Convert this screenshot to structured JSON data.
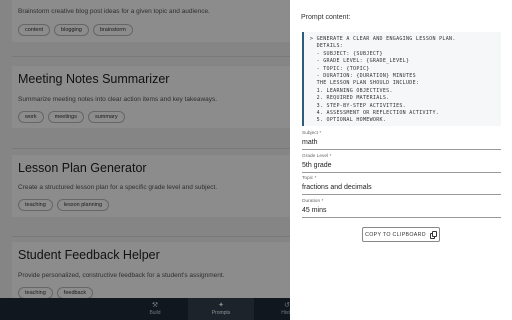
{
  "list": {
    "cards": [
      {
        "title": "",
        "description": "Brainstorm creative blog post ideas for a given topic and audience.",
        "tags": [
          "content",
          "blogging",
          "brainstorm"
        ]
      },
      {
        "title": "Meeting Notes Summarizer",
        "description": "Summarize meeting notes into clear action items and key takeaways.",
        "tags": [
          "work",
          "meetings",
          "summary"
        ]
      },
      {
        "title": "Lesson Plan Generator",
        "description": "Create a structured lesson plan for a specific grade level and subject.",
        "tags": [
          "teaching",
          "lesson planning"
        ]
      },
      {
        "title": "Student Feedback Helper",
        "description": "Provide personalized, constructive feedback for a student's assignment.",
        "tags": [
          "teaching",
          "feedback"
        ]
      }
    ]
  },
  "bottom_nav": {
    "items": [
      {
        "label": "Build",
        "icon": "build-icon"
      },
      {
        "label": "Prompts",
        "icon": "sparkle-icon"
      },
      {
        "label": "Histo",
        "icon": "history-icon"
      }
    ],
    "active": "Prompts"
  },
  "panel": {
    "title": "Prompt content:",
    "prompt_lines": [
      "> Generate a clear and engaging lesson plan.",
      "  Details:",
      "  - Subject: {Subject}",
      "  - Grade Level: {Grade_Level}",
      "  - Topic: {Topic}",
      "  - Duration: {Duration} minutes",
      "  The lesson plan should include:",
      "  1. Learning objectives.",
      "  2. Required materials.",
      "  3. Step-by-step activities.",
      "  4. Assessment or reflection activity.",
      "  5. Optional homework."
    ],
    "fields": [
      {
        "label": "Subject *",
        "value": "math"
      },
      {
        "label": "Grade Level *",
        "value": "5th grade"
      },
      {
        "label": "Topic *",
        "value": "fractions and decimals"
      },
      {
        "label": "Duration *",
        "value": "45 mins"
      }
    ],
    "copy_label": "Copy to Clipboard"
  },
  "colors": {
    "accent": "#2c5d7a",
    "nav_bg": "#1f2b3a",
    "overlay": "rgba(0,0,0,0.45)"
  }
}
